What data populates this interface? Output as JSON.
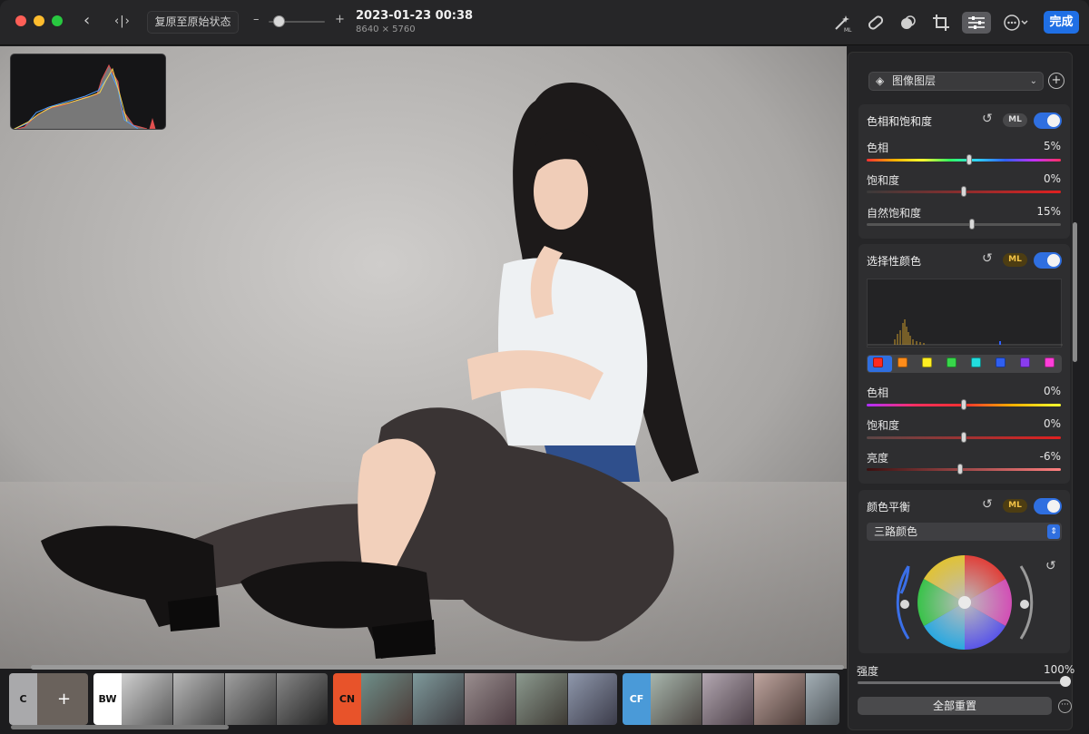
{
  "toolbar": {
    "revert_label": "复原至原始状态",
    "zoom_minus": "–",
    "zoom_plus": "+",
    "zoom_level": 0.1,
    "photo_date": "2023-01-23 00:38",
    "photo_dims": "8640 × 5760",
    "done_label": "完成",
    "icons": [
      "back-icon",
      "compare-icon",
      "magic-wand-ml-icon",
      "retouch-bandage-icon",
      "effects-icon",
      "crop-icon",
      "adjust-sliders-icon",
      "more-icon"
    ]
  },
  "inspector": {
    "layer": {
      "label": "图像图层"
    },
    "hue_sat": {
      "title": "色相和饱和度",
      "ml": "ML",
      "enabled": true,
      "sliders": [
        {
          "label": "色相",
          "value": "5%",
          "pos": 0.53
        },
        {
          "label": "饱和度",
          "value": "0%",
          "pos": 0.5
        },
        {
          "label": "自然饱和度",
          "value": "15%",
          "pos": 0.54
        }
      ]
    },
    "selective_color": {
      "title": "选择性颜色",
      "ml": "ML",
      "enabled": true,
      "swatches": [
        "#ff2a1f",
        "#ff8c1a",
        "#ffee22",
        "#38d64a",
        "#22dede",
        "#2f5ff0",
        "#8a3cf0",
        "#ff3ed8"
      ],
      "selected_swatch": 0,
      "sliders": [
        {
          "label": "色相",
          "value": "0%",
          "pos": 0.5
        },
        {
          "label": "饱和度",
          "value": "0%",
          "pos": 0.5
        },
        {
          "label": "亮度",
          "value": "-6%",
          "pos": 0.48
        }
      ]
    },
    "color_balance": {
      "title": "颜色平衡",
      "ml": "ML",
      "enabled": true,
      "mode": "三路颜色"
    },
    "strength": {
      "label": "强度",
      "value": "100%",
      "pos": 1.0
    },
    "reset_all": "全部重置"
  },
  "filmstrip": {
    "groups": [
      {
        "label": "C",
        "bg": "#a9a9ab",
        "fg": "#111111",
        "count": 1
      },
      {
        "label": "BW",
        "bg": "#ffffff",
        "fg": "#111111",
        "count": 4
      },
      {
        "label": "CN",
        "bg": "#e8532a",
        "fg": "#111111",
        "count": 5
      },
      {
        "label": "CF",
        "bg": "#4a9ad8",
        "fg": "#ffffff",
        "count": 4
      }
    ]
  },
  "colors": {
    "accent": "#2f6fe0",
    "ml_active": "#f2c246",
    "done": "#1f6fe5"
  }
}
